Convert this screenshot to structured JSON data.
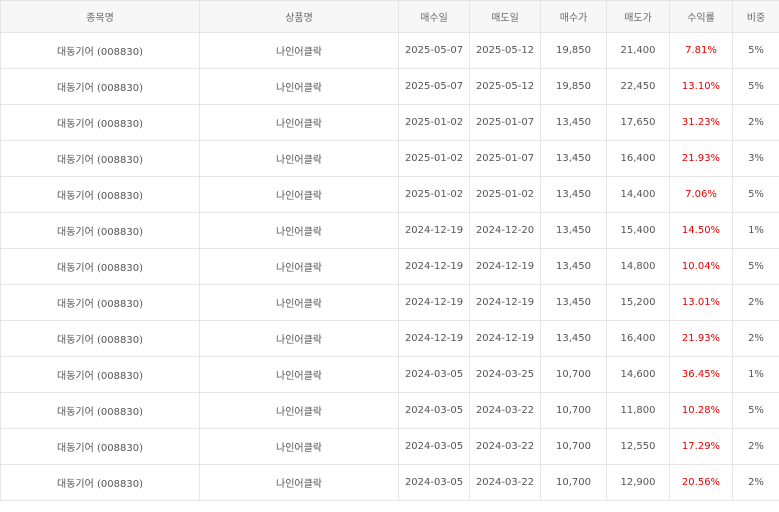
{
  "table": {
    "headers": [
      "종목명",
      "상품명",
      "매수일",
      "매도일",
      "매수가",
      "매도가",
      "수익률",
      "비중"
    ],
    "rows": [
      [
        "대동기어 (008830)",
        "나인어클락",
        "2025-05-07",
        "2025-05-12",
        "19,850",
        "21,400",
        "7.81%",
        "5%"
      ],
      [
        "대동기어 (008830)",
        "나인어클락",
        "2025-05-07",
        "2025-05-12",
        "19,850",
        "22,450",
        "13.10%",
        "5%"
      ],
      [
        "대동기어 (008830)",
        "나인어클락",
        "2025-01-02",
        "2025-01-07",
        "13,450",
        "17,650",
        "31.23%",
        "2%"
      ],
      [
        "대동기어 (008830)",
        "나인어클락",
        "2025-01-02",
        "2025-01-07",
        "13,450",
        "16,400",
        "21.93%",
        "3%"
      ],
      [
        "대동기어 (008830)",
        "나인어클락",
        "2025-01-02",
        "2025-01-02",
        "13,450",
        "14,400",
        "7.06%",
        "5%"
      ],
      [
        "대동기어 (008830)",
        "나인어클락",
        "2024-12-19",
        "2024-12-20",
        "13,450",
        "15,400",
        "14.50%",
        "1%"
      ],
      [
        "대동기어 (008830)",
        "나인어클락",
        "2024-12-19",
        "2024-12-19",
        "13,450",
        "14,800",
        "10.04%",
        "5%"
      ],
      [
        "대동기어 (008830)",
        "나인어클락",
        "2024-12-19",
        "2024-12-19",
        "13,450",
        "15,200",
        "13.01%",
        "2%"
      ],
      [
        "대동기어 (008830)",
        "나인어클락",
        "2024-12-19",
        "2024-12-19",
        "13,450",
        "16,400",
        "21.93%",
        "2%"
      ],
      [
        "대동기어 (008830)",
        "나인어클락",
        "2024-03-05",
        "2024-03-25",
        "10,700",
        "14,600",
        "36.45%",
        "1%"
      ],
      [
        "대동기어 (008830)",
        "나인어클락",
        "2024-03-05",
        "2024-03-22",
        "10,700",
        "11,800",
        "10.28%",
        "5%"
      ],
      [
        "대동기어 (008830)",
        "나인어클락",
        "2024-03-05",
        "2024-03-22",
        "10,700",
        "12,550",
        "17.29%",
        "2%"
      ],
      [
        "대동기어 (008830)",
        "나인어클락",
        "2024-03-05",
        "2024-03-22",
        "10,700",
        "12,900",
        "20.56%",
        "2%"
      ]
    ]
  },
  "colors": {
    "return_positive": "#e60000",
    "header_bg": "#f7f7f7",
    "border": "#e6e6e6",
    "text": "#555555"
  }
}
